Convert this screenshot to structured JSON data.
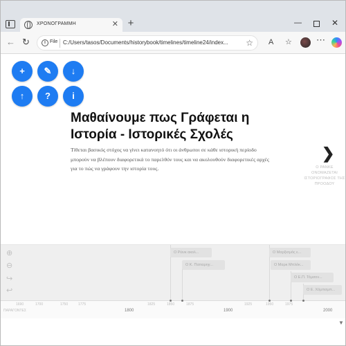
{
  "browser": {
    "tab_title": "ΧΡΟΝΟΓΡΑΜΜΗ",
    "tab_close": "✕",
    "new_tab": "+",
    "file_chip": "File",
    "url": "C:/Users/tasos/Documents/historybook/timelines/timeline24/index...",
    "controls": {
      "minimize": "—",
      "close": "✕"
    }
  },
  "toolbar": {
    "back": "←",
    "reload": "↻",
    "favorite": "☆",
    "read_aloud": "A",
    "favorites": "☆",
    "more": "⋯"
  },
  "action_buttons": [
    {
      "name": "add",
      "glyph": "+"
    },
    {
      "name": "edit",
      "glyph": "✎"
    },
    {
      "name": "download",
      "glyph": "↓"
    },
    {
      "name": "upload",
      "glyph": "↑"
    },
    {
      "name": "help",
      "glyph": "?"
    },
    {
      "name": "info",
      "glyph": "i"
    }
  ],
  "slide": {
    "headline": "Μαθαίνουμε πως Γράφεται η Ιστορία - Ιστορικές Σχολές",
    "lead": "Τίθεται βασικός στόχος να γίνει κατανοητό ότι οι άνθρωποι σε κάθε ιστορική περίοδο μπορούν να βλέπουν διαφορετικά το παρελθόν τους και να ακολουθούν διαφορετικές αρχές για το πώς να γράφουν την ιστορία τους.",
    "next_arrow": "❯",
    "next_label": "Ο ΡΑΝΚΕ ΟΝΟΜΑΖΕΤΑΙ ΙΣΤΟΡΙΟΓΡΑΦΟΣ ΤΗΣ ΠΡΟΟΔΟΥ"
  },
  "timeline_tools": {
    "zoom_in": "⊕",
    "zoom_out": "⊖",
    "forward": "↪",
    "back": "↩"
  },
  "events": [
    "Ο Ρέινκ ακολ...",
    "Ο Κ. Παπαρηγ...",
    "Ο Μαρξισμός ε...",
    "Ο Μαρκ Μπλόκ...",
    "Ο Ε.Π. Τόμσον...",
    "Ο Ε. Χόμπσμπ..."
  ],
  "axis": {
    "start_label": "ΠΑΡΑΓΟΝΤΕΣ",
    "minor_ticks": [
      "1690",
      "1700",
      "1750",
      "1775",
      "1825",
      "1850",
      "1875",
      "1925",
      "1950",
      "1975"
    ],
    "major_ticks": [
      "1800",
      "1900",
      "2000"
    ]
  },
  "colors": {
    "accent": "#1e7cf2",
    "headline": "#111111",
    "lead": "#555555",
    "timeline_bg": "#efefef"
  }
}
